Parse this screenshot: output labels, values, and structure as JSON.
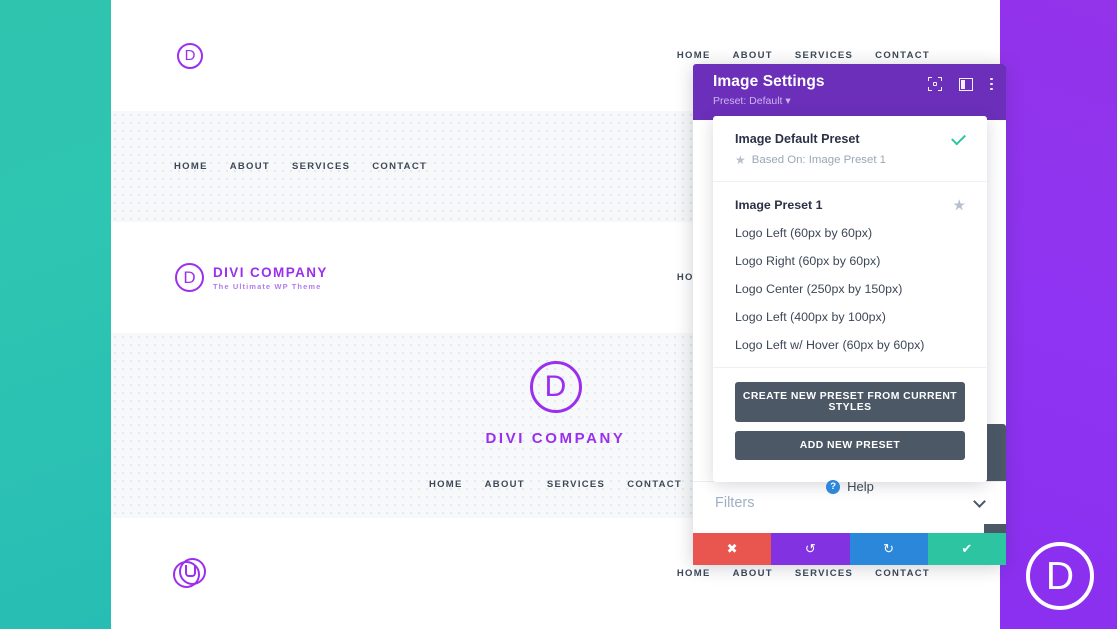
{
  "theme": {
    "accent_purple": "#9b2fef",
    "header_purple": "#6b2fba",
    "teal": "#2dc4a2",
    "dark_button": "#4c5866",
    "red": "#e9564f",
    "blue": "#2b87da"
  },
  "website": {
    "nav_links": [
      "HOME",
      "ABOUT",
      "SERVICES",
      "CONTACT"
    ],
    "brand_name": "DIVI COMPANY",
    "brand_tagline": "The Ultimate WP Theme",
    "logo_letter": "D",
    "watermark_letter": "D"
  },
  "modal": {
    "title": "Image Settings",
    "preset_label": "Preset: Default",
    "icons": {
      "focus": "focus-frame-icon",
      "panel": "layout-panel-icon",
      "more": "more-options-icon"
    },
    "filters": {
      "label": "Filters",
      "chevron": "chevron-down-icon"
    },
    "actions": {
      "discard": "✖",
      "undo": "↺",
      "redo": "↻",
      "save": "✔"
    }
  },
  "dropdown": {
    "default_preset": {
      "name": "Image Default Preset",
      "based_on": "Based On: Image Preset 1",
      "star": "★",
      "selected": true
    },
    "presets": [
      {
        "label": "Image Preset 1",
        "is_default_star": true
      },
      {
        "label": "Logo Left (60px by 60px)",
        "is_default_star": false
      },
      {
        "label": "Logo Right (60px by 60px)",
        "is_default_star": false
      },
      {
        "label": "Logo Center (250px by 150px)",
        "is_default_star": false
      },
      {
        "label": "Logo Left (400px by 100px)",
        "is_default_star": false
      },
      {
        "label": "Logo Left w/ Hover (60px by 60px)",
        "is_default_star": false
      }
    ],
    "create_from_styles_label": "CREATE NEW PRESET FROM CURRENT STYLES",
    "add_new_label": "ADD NEW PRESET",
    "help_label": "Help",
    "help_icon_glyph": "?"
  }
}
